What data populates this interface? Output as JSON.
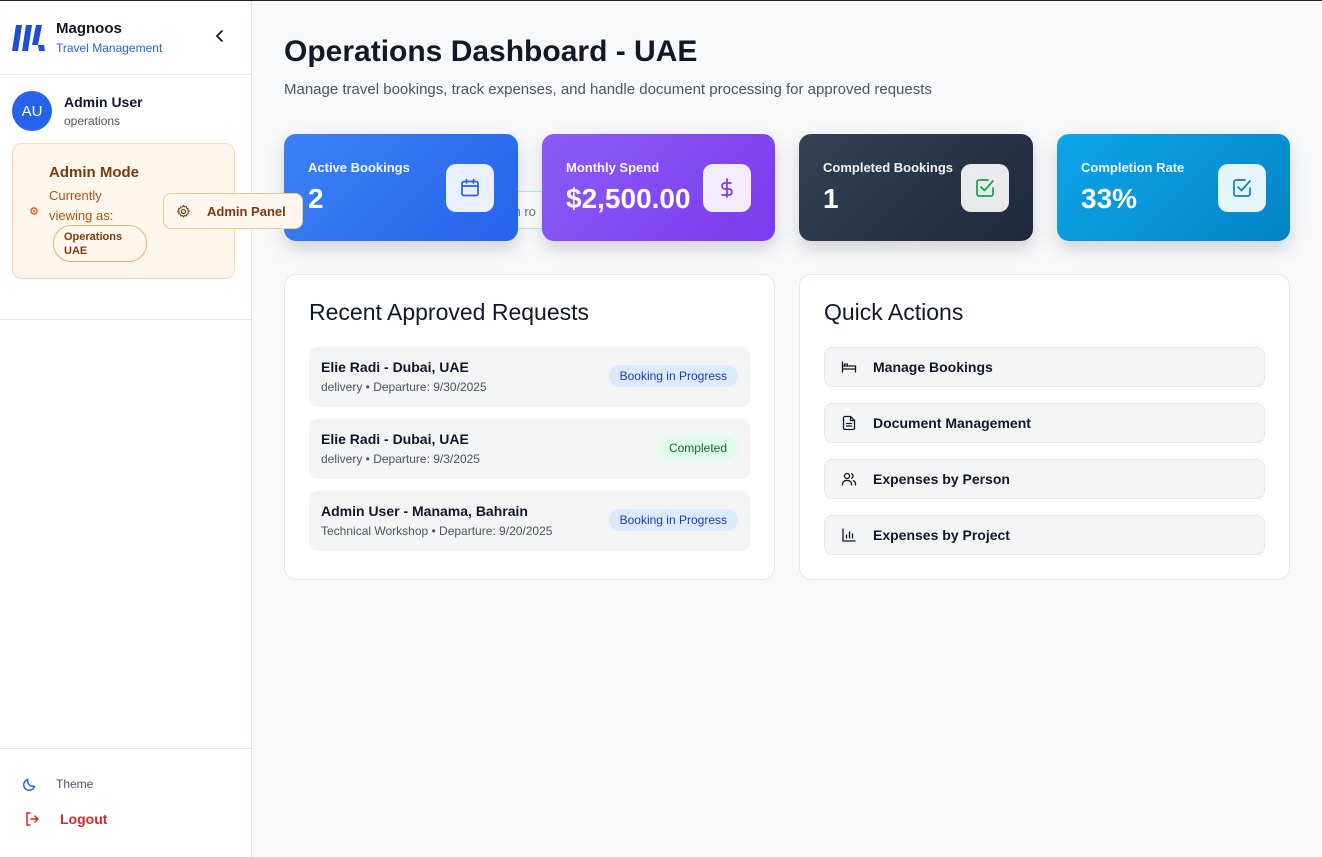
{
  "sidebar": {
    "brand_name": "Magnoos",
    "brand_sub": "Travel Management",
    "user": {
      "initials": "AU",
      "name": "Admin User",
      "role": "operations"
    },
    "admin": {
      "title": "Admin Mode",
      "viewing_label": "Currently viewing as:",
      "viewing_value": "Operations UAE",
      "panel_button": "Admin Panel"
    },
    "theme_label": "Theme",
    "logout_label": "Logout"
  },
  "main": {
    "title": "Operations Dashboard - UAE",
    "subtitle": "Manage travel bookings, track expenses, and handle document processing for approved requests",
    "hidden_search_fragment": "ch ro",
    "stats": [
      {
        "label": "Active Bookings",
        "value": "2",
        "icon": "calendar-icon"
      },
      {
        "label": "Monthly Spend",
        "value": "$2,500.00",
        "icon": "dollar-icon"
      },
      {
        "label": "Completed Bookings",
        "value": "1",
        "icon": "check-square-icon"
      },
      {
        "label": "Completion Rate",
        "value": "33%",
        "icon": "check-square-icon"
      }
    ],
    "recent": {
      "title": "Recent Approved Requests",
      "items": [
        {
          "title": "Elie Radi - Dubai, UAE",
          "meta": "delivery • Departure: 9/30/2025",
          "status": "Booking in Progress"
        },
        {
          "title": "Elie Radi - Dubai, UAE",
          "meta": "delivery • Departure: 9/3/2025",
          "status": "Completed"
        },
        {
          "title": "Admin User - Manama, Bahrain",
          "meta": "Technical Workshop • Departure: 9/20/2025",
          "status": "Booking in Progress"
        }
      ]
    },
    "quick_actions": {
      "title": "Quick Actions",
      "items": [
        {
          "label": "Manage Bookings",
          "icon": "bed-icon"
        },
        {
          "label": "Document Management",
          "icon": "document-icon"
        },
        {
          "label": "Expenses by Person",
          "icon": "users-icon"
        },
        {
          "label": "Expenses by Project",
          "icon": "bar-chart-icon"
        }
      ]
    }
  },
  "colors": {
    "accent": "#2563eb",
    "admin_bg": "#fff7ed",
    "admin_text": "#7c3a10",
    "logout": "#dc2626"
  }
}
